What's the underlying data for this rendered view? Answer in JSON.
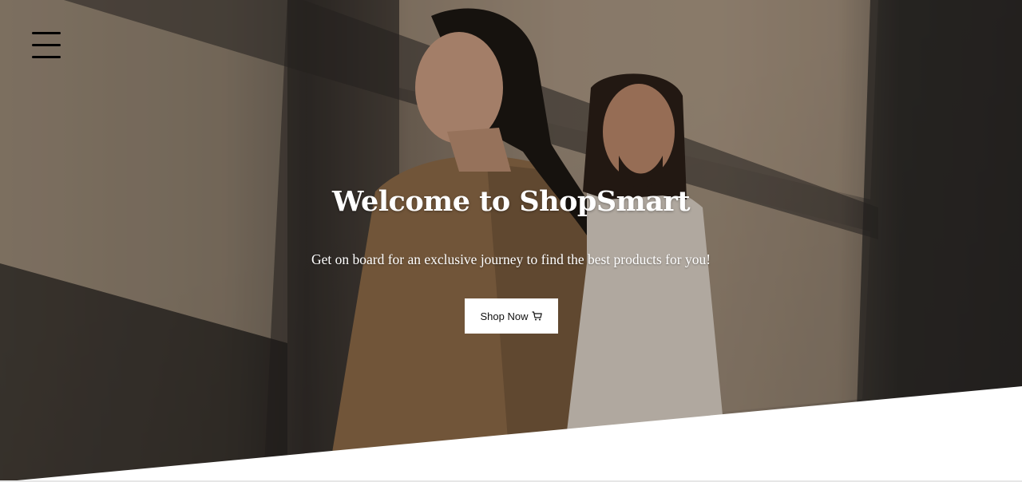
{
  "hero": {
    "title": "Welcome to ShopSmart",
    "subtitle": "Get on board for an exclusive journey to find the best products for you!",
    "cta_label": "Shop Now",
    "cta_icon": "cart-icon"
  },
  "nav": {
    "menu_icon": "hamburger-menu-icon"
  },
  "colors": {
    "hero_text": "#ffffff",
    "button_bg": "#ffffff",
    "button_text": "#111111",
    "menu_icon": "#000000"
  }
}
